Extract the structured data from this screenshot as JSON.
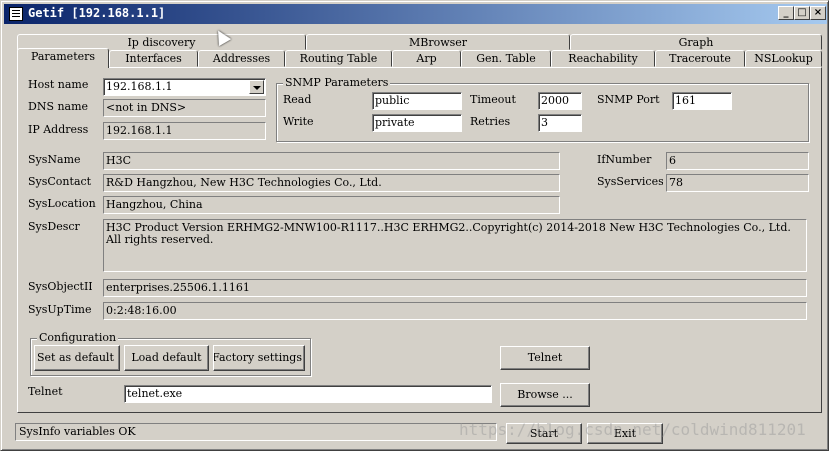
{
  "window": {
    "title": "Getif [192.168.1.1]",
    "controls": {
      "minimize": "_",
      "maximize": "□",
      "close": "×"
    }
  },
  "tabs_row1": [
    "Ip discovery",
    "MBrowser",
    "Graph"
  ],
  "tabs_row2": [
    "Parameters",
    "Interfaces",
    "Addresses",
    "Routing Table",
    "Arp",
    "Gen. Table",
    "Reachability",
    "Traceroute",
    "NSLookup"
  ],
  "active_tab": "Parameters",
  "host": {
    "host_name_label": "Host name",
    "host_name_value": "192.168.1.1",
    "dns_label": "DNS name",
    "dns_value": "<not in DNS>",
    "ip_label": "IP Address",
    "ip_value": "192.168.1.1"
  },
  "snmp": {
    "legend": "SNMP Parameters",
    "read_label": "Read",
    "read_value": "public",
    "write_label": "Write",
    "write_value": "private",
    "timeout_label": "Timeout",
    "timeout_value": "2000",
    "retries_label": "Retries",
    "retries_value": "3",
    "port_label": "SNMP Port",
    "port_value": "161"
  },
  "sysinfo": {
    "sysname_label": "SysName",
    "sysname_value": "H3C",
    "syscontact_label": "SysContact",
    "syscontact_value": "R&D Hangzhou, New H3C Technologies Co., Ltd.",
    "syslocation_label": "SysLocation",
    "syslocation_value": "Hangzhou, China",
    "sysdescr_label": "SysDescr",
    "sysdescr_value": "H3C Product Version ERHMG2-MNW100-R1117..H3C ERHMG2..Copyright(c) 2014-2018 New H3C Technologies Co., Ltd. All rights reserved.",
    "sysobjectid_label": "SysObjectII",
    "sysobjectid_value": "enterprises.25506.1.1161",
    "sysuptime_label": "SysUpTime",
    "sysuptime_value": "0:2:48:16.00",
    "ifnumber_label": "IfNumber",
    "ifnumber_value": "6",
    "sysservices_label": "SysServices",
    "sysservices_value": "78"
  },
  "configuration": {
    "legend": "Configuration",
    "set_default": "Set as default",
    "load_default": "Load default",
    "factory_settings": "Factory settings"
  },
  "telnet": {
    "button": "Telnet",
    "label": "Telnet",
    "value": "telnet.exe",
    "browse": "Browse ..."
  },
  "status": {
    "text": "SysInfo variables OK"
  },
  "footer": {
    "start": "Start",
    "exit": "Exit"
  },
  "watermark": "https://blog.csdn.net/coldwind811201"
}
